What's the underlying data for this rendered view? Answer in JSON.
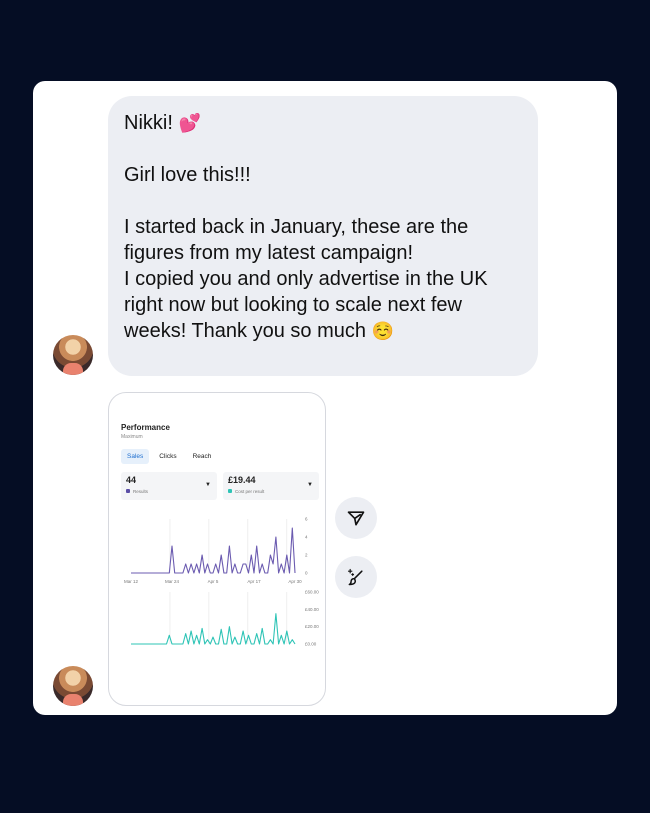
{
  "message": {
    "greeting": "Nikki!",
    "greeting_emoji": "💕",
    "line2": "Girl love this!!!",
    "line3": "I started back in January, these are the figures from my latest campaign!",
    "line4": "I copied you and only advertise in the UK right now but looking to scale next few weeks! Thank you so much",
    "closing_emoji": "☺️"
  },
  "screenshot": {
    "title": "Performance",
    "subtitle": "Maximum",
    "tabs": [
      "Sales",
      "Clicks",
      "Reach"
    ],
    "active_tab": "Sales",
    "metric1": {
      "value": "44",
      "label": "Results",
      "color": "#5b4fa6"
    },
    "metric2": {
      "value": "£19.44",
      "label": "Cost per result",
      "color": "#2ec4b6"
    }
  },
  "chart_data": [
    {
      "type": "line",
      "x_ticks": [
        "Mar 12",
        "Mar 24",
        "Apr 5",
        "Apr 17",
        "Apr 30"
      ],
      "y_ticks": [
        "0",
        "2",
        "4",
        "6"
      ],
      "ylim": [
        0,
        6
      ],
      "series": [
        {
          "color": "#6b5bb0",
          "values": [
            0,
            0,
            0,
            0,
            0,
            0,
            0,
            0,
            0,
            0,
            0,
            0,
            0,
            0,
            0,
            3,
            0,
            0,
            0,
            0,
            1,
            0,
            1,
            0,
            1,
            0,
            2,
            0,
            1,
            0,
            0,
            1,
            0,
            2,
            0,
            0,
            3,
            0,
            1,
            0,
            0,
            1,
            1,
            0,
            2,
            0,
            3,
            0,
            1,
            0,
            0,
            2,
            1,
            4,
            0,
            1,
            0,
            2,
            0,
            5,
            0
          ]
        }
      ]
    },
    {
      "type": "line",
      "y_ticks": [
        "£0.00",
        "£20.00",
        "£40.00",
        "£60.00"
      ],
      "ylim": [
        0,
        60
      ],
      "series": [
        {
          "color": "#2ec4b6",
          "values": [
            0,
            0,
            0,
            0,
            0,
            0,
            0,
            0,
            0,
            0,
            0,
            0,
            0,
            0,
            10,
            0,
            0,
            0,
            0,
            0,
            12,
            0,
            15,
            0,
            10,
            0,
            18,
            0,
            5,
            0,
            8,
            0,
            0,
            17,
            0,
            0,
            20,
            0,
            8,
            0,
            0,
            15,
            0,
            10,
            0,
            0,
            12,
            0,
            18,
            0,
            0,
            5,
            0,
            35,
            0,
            10,
            0,
            15,
            0,
            5,
            0
          ]
        }
      ]
    }
  ],
  "actions": {
    "share_icon": "send-icon",
    "edit_icon": "magic-brush-icon"
  }
}
